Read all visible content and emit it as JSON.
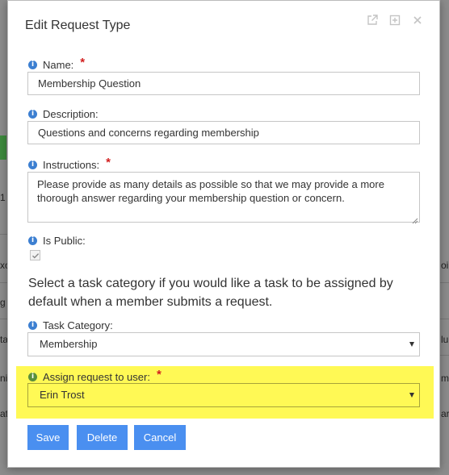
{
  "background": {
    "fragments": [
      "ne",
      "1",
      "xo",
      "oi",
      "g",
      "ta",
      "ni",
      "lu",
      "ma",
      "are",
      "ati"
    ]
  },
  "dialog": {
    "title": "Edit Request Type",
    "controls": [
      "external-link-icon",
      "maximize-icon",
      "close-icon"
    ]
  },
  "form": {
    "name": {
      "label": "Name:",
      "required": true,
      "value": "Membership Question"
    },
    "description": {
      "label": "Description:",
      "required": false,
      "value": "Questions and concerns regarding membership"
    },
    "instructions": {
      "label": "Instructions:",
      "required": true,
      "value": "Please provide as many details as possible so that we may provide a more thorough answer regarding your membership question or concern."
    },
    "is_public": {
      "label": "Is Public:",
      "checked": true
    },
    "helper_text": "Select a task category if you would like a task to be assigned by default when a member submits a request.",
    "task_category": {
      "label": "Task Category:",
      "value": "Membership"
    },
    "assign_user": {
      "label": "Assign request to user:",
      "required": true,
      "value": "Erin Trost"
    }
  },
  "buttons": {
    "save": "Save",
    "delete": "Delete",
    "cancel": "Cancel"
  },
  "colors": {
    "primary_button": "#4a8ff0",
    "info_icon": "#3c7fd1",
    "required_star": "#d21f1f",
    "highlight": "#fff955"
  }
}
